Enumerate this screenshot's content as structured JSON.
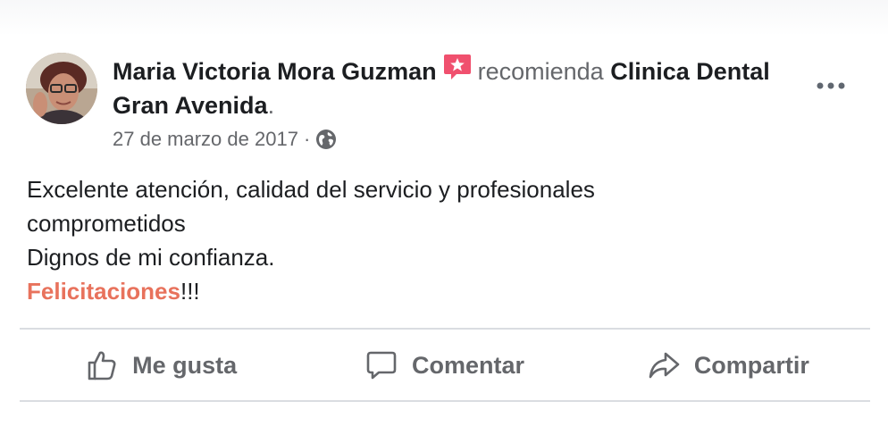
{
  "post": {
    "author": "Maria Victoria Mora Guzman",
    "verb": "recomienda",
    "page": "Clinica Dental Gran Avenida",
    "period": ".",
    "date": "27 de marzo de 2017",
    "separator": "·",
    "audience_icon": "globe-icon",
    "recommend_icon": "recommend-star-icon",
    "more_icon": "more-options-icon",
    "text_line1": "Excelente atención, calidad del servicio y profesionales comprometidos",
    "text_line2": "Dignos de mi confianza.",
    "hashtag": "Felicitaciones",
    "hashtag_suffix": "!!!"
  },
  "actions": {
    "like_label": "Me gusta",
    "like_icon": "thumbs-up-icon",
    "comment_label": "Comentar",
    "comment_icon": "comment-bubble-icon",
    "share_label": "Compartir",
    "share_icon": "share-arrow-icon"
  },
  "colors": {
    "text": "#1c1e21",
    "secondary": "#65676b",
    "hashtag": "#e8725c",
    "recommend": "#f0506e",
    "divider": "#dadde1"
  }
}
